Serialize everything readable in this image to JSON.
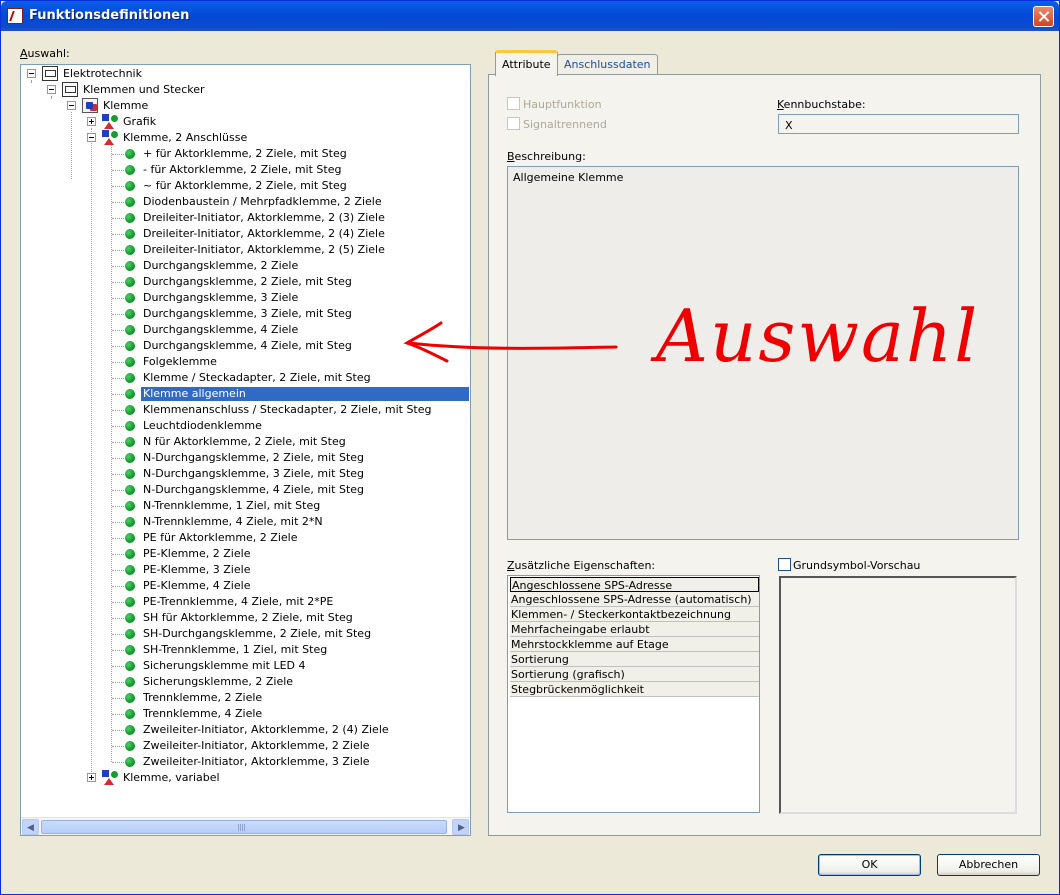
{
  "window": {
    "title": "Funktionsdefinitionen"
  },
  "left": {
    "auswahl_label": "Auswahl:",
    "tree": {
      "root": "Elektrotechnik",
      "level1": "Klemmen und Stecker",
      "level2": "Klemme",
      "grafik": "Grafik",
      "group_open": "Klemme, 2 Anschlüsse",
      "items": [
        "+ für Aktorklemme, 2 Ziele, mit Steg",
        "- für Aktorklemme, 2 Ziele, mit Steg",
        "~ für Aktorklemme, 2 Ziele, mit Steg",
        "Diodenbaustein / Mehrpfadklemme, 2 Ziele",
        "Dreileiter-Initiator, Aktorklemme, 2 (3) Ziele",
        "Dreileiter-Initiator, Aktorklemme, 2 (4) Ziele",
        "Dreileiter-Initiator, Aktorklemme, 2 (5) Ziele",
        "Durchgangsklemme, 2 Ziele",
        "Durchgangsklemme, 2 Ziele, mit Steg",
        "Durchgangsklemme, 3 Ziele",
        "Durchgangsklemme, 3 Ziele, mit Steg",
        "Durchgangsklemme, 4 Ziele",
        "Durchgangsklemme, 4 Ziele, mit Steg",
        "Folgeklemme",
        "Klemme / Steckadapter, 2 Ziele, mit Steg",
        "Klemme allgemein",
        "Klemmenanschluss / Steckadapter, 2 Ziele, mit Steg",
        "Leuchtdiodenklemme",
        "N für Aktorklemme, 2 Ziele, mit Steg",
        "N-Durchgangsklemme, 2 Ziele, mit Steg",
        "N-Durchgangsklemme, 3 Ziele, mit Steg",
        "N-Durchgangsklemme, 4 Ziele, mit Steg",
        "N-Trennklemme, 1 Ziel, mit Steg",
        "N-Trennklemme, 4 Ziele, mit 2*N",
        "PE für Aktorklemme, 2 Ziele",
        "PE-Klemme, 2 Ziele",
        "PE-Klemme, 3 Ziele",
        "PE-Klemme, 4 Ziele",
        "PE-Trennklemme, 4 Ziele, mit 2*PE",
        "SH für Aktorklemme, 2 Ziele, mit Steg",
        "SH-Durchgangsklemme, 2 Ziele, mit Steg",
        "SH-Trennklemme, 1 Ziel, mit Steg",
        "Sicherungsklemme mit LED 4",
        "Sicherungsklemme, 2 Ziele",
        "Trennklemme, 2 Ziele",
        "Trennklemme, 4 Ziele",
        "Zweileiter-Initiator, Aktorklemme, 2 (4) Ziele",
        "Zweileiter-Initiator, Aktorklemme, 2 Ziele",
        "Zweileiter-Initiator, Aktorklemme, 3 Ziele"
      ],
      "selected": "Klemme allgemein",
      "group_closed": "Klemme, variabel"
    }
  },
  "tabs": {
    "attribute": "Attribute",
    "anschlussdaten": "Anschlussdaten",
    "active": "Attribute"
  },
  "attribute": {
    "hauptfunktion": "Hauptfunktion",
    "signaltrennend": "Signaltrennend",
    "kennbuchstabe_label": "Kennbuchstabe:",
    "kennbuchstabe_value": "X",
    "beschreibung_label": "Beschreibung:",
    "beschreibung_value": "Allgemeine Klemme",
    "zusaetzliche_label": "Zusätzliche Eigenschaften:",
    "properties": [
      "Angeschlossene SPS-Adresse",
      "Angeschlossene SPS-Adresse (automatisch)",
      "Klemmen- / Steckerkontaktbezeichnung",
      "Mehrfacheingabe erlaubt",
      "Mehrstockklemme auf Etage",
      "Sortierung",
      "Sortierung (grafisch)",
      "Stegbrückenmöglichkeit"
    ],
    "grundsymbol_label": "Grundsymbol-Vorschau"
  },
  "buttons": {
    "ok": "OK",
    "abbrechen": "Abbrechen"
  },
  "annotation": {
    "text": "Auswahl",
    "color": "#ee0000"
  },
  "colors": {
    "title_bar": "#0349d5",
    "selection": "#316ac5",
    "dialog_bg": "#ece9d8",
    "tab_accent": "#ffc83c"
  }
}
